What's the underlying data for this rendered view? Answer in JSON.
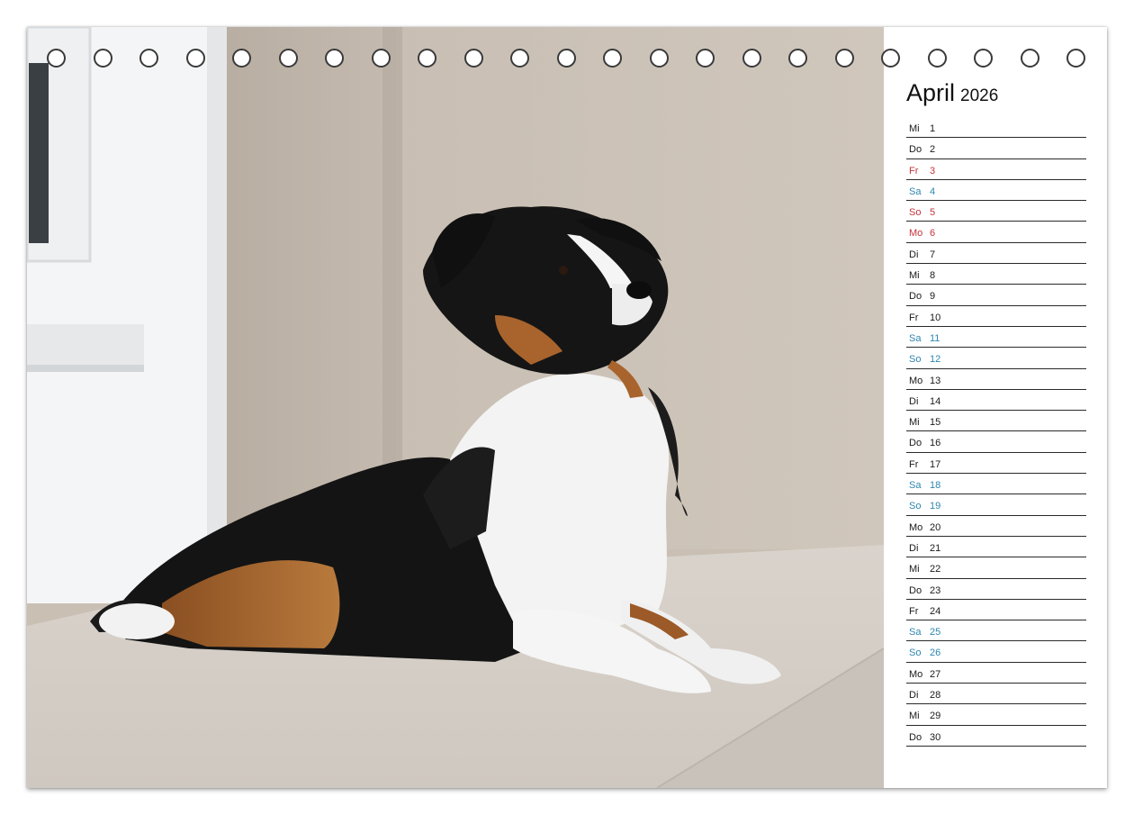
{
  "calendar": {
    "month": "April",
    "year": "2026",
    "days": [
      {
        "wd": "Mi",
        "num": "1",
        "type": "normal"
      },
      {
        "wd": "Do",
        "num": "2",
        "type": "normal"
      },
      {
        "wd": "Fr",
        "num": "3",
        "type": "holiday"
      },
      {
        "wd": "Sa",
        "num": "4",
        "type": "weekend"
      },
      {
        "wd": "So",
        "num": "5",
        "type": "holiday"
      },
      {
        "wd": "Mo",
        "num": "6",
        "type": "holiday"
      },
      {
        "wd": "Di",
        "num": "7",
        "type": "normal"
      },
      {
        "wd": "Mi",
        "num": "8",
        "type": "normal"
      },
      {
        "wd": "Do",
        "num": "9",
        "type": "normal"
      },
      {
        "wd": "Fr",
        "num": "10",
        "type": "normal"
      },
      {
        "wd": "Sa",
        "num": "11",
        "type": "weekend"
      },
      {
        "wd": "So",
        "num": "12",
        "type": "weekend"
      },
      {
        "wd": "Mo",
        "num": "13",
        "type": "normal"
      },
      {
        "wd": "Di",
        "num": "14",
        "type": "normal"
      },
      {
        "wd": "Mi",
        "num": "15",
        "type": "normal"
      },
      {
        "wd": "Do",
        "num": "16",
        "type": "normal"
      },
      {
        "wd": "Fr",
        "num": "17",
        "type": "normal"
      },
      {
        "wd": "Sa",
        "num": "18",
        "type": "weekend"
      },
      {
        "wd": "So",
        "num": "19",
        "type": "weekend"
      },
      {
        "wd": "Mo",
        "num": "20",
        "type": "normal"
      },
      {
        "wd": "Di",
        "num": "21",
        "type": "normal"
      },
      {
        "wd": "Mi",
        "num": "22",
        "type": "normal"
      },
      {
        "wd": "Do",
        "num": "23",
        "type": "normal"
      },
      {
        "wd": "Fr",
        "num": "24",
        "type": "normal"
      },
      {
        "wd": "Sa",
        "num": "25",
        "type": "weekend"
      },
      {
        "wd": "So",
        "num": "26",
        "type": "weekend"
      },
      {
        "wd": "Mo",
        "num": "27",
        "type": "normal"
      },
      {
        "wd": "Di",
        "num": "28",
        "type": "normal"
      },
      {
        "wd": "Mi",
        "num": "29",
        "type": "normal"
      },
      {
        "wd": "Do",
        "num": "30",
        "type": "normal"
      }
    ]
  },
  "colors": {
    "weekend": "#2f86b0",
    "holiday": "#c6343b",
    "normal": "#1a1a1a"
  },
  "photo": {
    "subject": "tricolor-dog-lying-on-step-icon"
  }
}
